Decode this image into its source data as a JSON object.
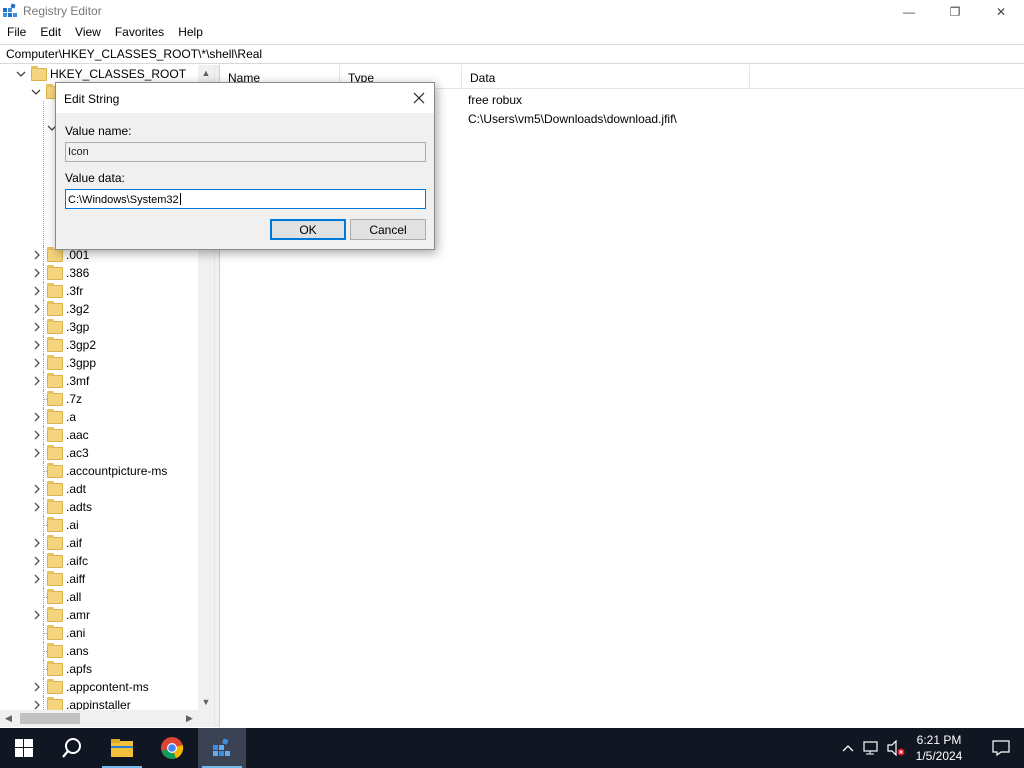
{
  "window": {
    "title": "Registry Editor",
    "minimize_glyph": "—",
    "maximize_glyph": "❐",
    "close_glyph": "✕"
  },
  "menu": [
    "File",
    "Edit",
    "View",
    "Favorites",
    "Help"
  ],
  "address": "Computer\\HKEY_CLASSES_ROOT\\*\\shell\\Real",
  "tree": {
    "root_label": "HKEY_CLASSES_ROOT",
    "items": [
      ".001",
      ".386",
      ".3fr",
      ".3g2",
      ".3gp",
      ".3gp2",
      ".3gpp",
      ".3mf",
      ".7z",
      ".a",
      ".aac",
      ".ac3",
      ".accountpicture-ms",
      ".adt",
      ".adts",
      ".ai",
      ".aif",
      ".aifc",
      ".aiff",
      ".all",
      ".amr",
      ".ani",
      ".ans",
      ".apfs",
      ".appcontent-ms",
      ".appinstaller"
    ]
  },
  "list": {
    "columns": [
      "Name",
      "Type",
      "Data"
    ],
    "rows": [
      {
        "name": "",
        "type": "",
        "data": "free robux"
      },
      {
        "name": "",
        "type": "",
        "data": "C:\\Users\\vm5\\Downloads\\download.jfif\\"
      }
    ]
  },
  "dialog": {
    "title": "Edit String",
    "value_name_label": "Value name:",
    "value_name": "Icon",
    "value_data_label": "Value data:",
    "value_data": "C:\\Windows\\System32",
    "ok_label": "OK",
    "cancel_label": "Cancel"
  },
  "taskbar": {
    "apps": [
      "start-icon",
      "search-icon",
      "file-explorer-icon",
      "chrome-icon",
      "regedit-icon"
    ],
    "time": "6:21 PM",
    "date": "1/5/2024"
  },
  "colors": {
    "accent": "#0078d7",
    "taskbar": "#101622",
    "folder": "#f4d47c"
  }
}
